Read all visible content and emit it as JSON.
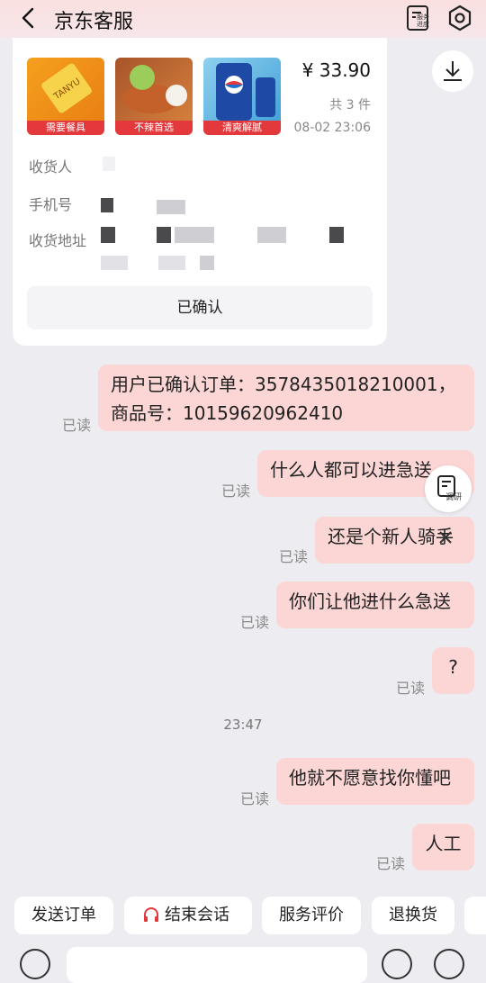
{
  "header": {
    "title": "京东客服",
    "service_progress_label": "服务\n进度"
  },
  "order": {
    "items": [
      {
        "tag": "需要餐具",
        "brand": "TANYU"
      },
      {
        "tag": "不辣首选"
      },
      {
        "tag": "清爽解腻"
      }
    ],
    "price": "¥ 33.90",
    "count": "共 3 件",
    "time": "08-02 23:06",
    "receiver_label": "收货人",
    "phone_label": "手机号",
    "address_label": "收货地址",
    "confirm_label": "已确认"
  },
  "messages": [
    {
      "text": "用户已确认订单：3578435018210001，商品号：10159620962410",
      "status": "已读"
    },
    {
      "text": "什么人都可以进急送",
      "status": "已读"
    },
    {
      "text": "还是个新人骑手",
      "status": "已读"
    },
    {
      "text": "你们让他进什么急送",
      "status": "已读"
    },
    {
      "text": "?",
      "status": "已读"
    },
    {
      "text": "他就不愿意找你懂吧",
      "status": "已读"
    },
    {
      "text": "人工",
      "status": "已读"
    }
  ],
  "timestamp": "23:47",
  "feedback_label": "调研",
  "quick_actions": [
    "发送订单",
    "结束会话",
    "服务评价",
    "退换货"
  ],
  "colors": {
    "bubble": "#fbd6d5",
    "accent": "#e4393c"
  }
}
